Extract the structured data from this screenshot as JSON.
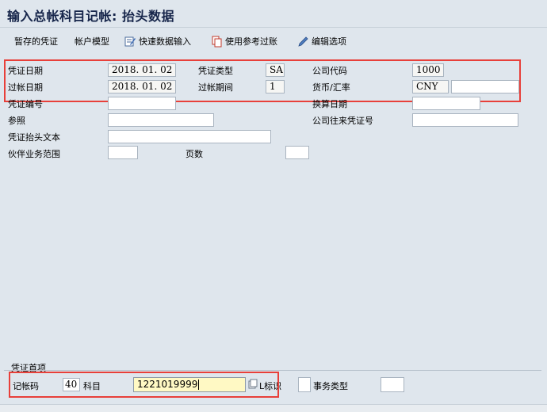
{
  "title": "输入总帐科目记帐: 抬头数据",
  "toolbar": {
    "held_doc": "暂存的凭证",
    "acct_model": "帐户模型",
    "fast_entry": "快速数据输入",
    "post_ref": "使用参考过账",
    "edit_options": "编辑选项"
  },
  "header": {
    "doc_date_label": "凭证日期",
    "doc_date": "2018. 01. 02",
    "doc_type_label": "凭证类型",
    "doc_type": "SA",
    "company_code_label": "公司代码",
    "company_code": "1000",
    "posting_date_label": "过帐日期",
    "posting_date": "2018. 01. 02",
    "period_label": "过帐期间",
    "period": "1",
    "currency_label": "货币/汇率",
    "currency": "CNY",
    "exchange_rate": "",
    "doc_number_label": "凭证编号",
    "doc_number": "",
    "translation_date_label": "换算日期",
    "translation_date": "",
    "reference_label": "参照",
    "reference": "",
    "intercompany_label": "公司往来凭证号",
    "intercompany": "",
    "header_text_label": "凭证抬头文本",
    "header_text": "",
    "partner_ba_label": "伙伴业务范围",
    "partner_ba": "",
    "page_count_label": "页数",
    "page_count": ""
  },
  "first_item": {
    "group_title": "凭证首项",
    "posting_key_label": "记帐码",
    "posting_key": "40",
    "account_label": "科目",
    "account": "1221019999",
    "sgl_label": "L标识",
    "sgl": "",
    "trans_type_label": "事务类型",
    "trans_type": ""
  },
  "colors": {
    "highlight_box": "#e8403a",
    "active_field": "#fff9c4",
    "background": "#dfe6ed"
  }
}
